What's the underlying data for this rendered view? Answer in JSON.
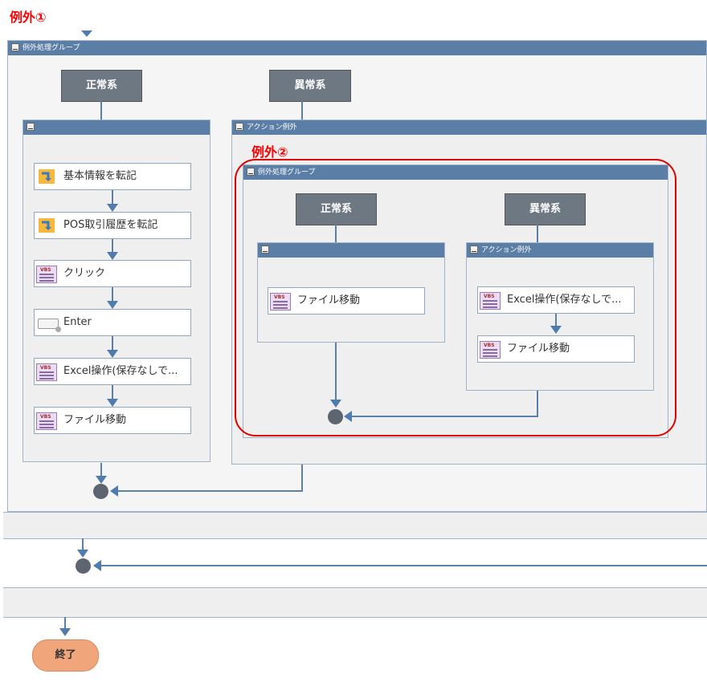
{
  "annotations": {
    "ex1": "例外①",
    "ex2": "例外②"
  },
  "outer_group": {
    "title": "例外処理グループ"
  },
  "outer_normal": {
    "branch_label": "正常系"
  },
  "outer_exception": {
    "branch_label": "異常系",
    "panel_title": "アクション例外"
  },
  "actions": [
    {
      "label": "基本情報を転記",
      "icon": "transfer-icon"
    },
    {
      "label": "POS取引履歴を転記",
      "icon": "transfer-icon"
    },
    {
      "label": "クリック",
      "icon": "vbs-script-icon"
    },
    {
      "label": "Enter",
      "icon": "keyboard-icon"
    },
    {
      "label": "Excel操作(保存なしで...",
      "icon": "vbs-script-icon"
    },
    {
      "label": "ファイル移動",
      "icon": "vbs-script-icon"
    }
  ],
  "inner_group": {
    "title": "例外処理グループ",
    "normal_label": "正常系",
    "exception_label": "異常系",
    "exception_panel_title": "アクション例外",
    "normal_action": "ファイル移動",
    "exception_actions": [
      "Excel操作(保存なしで...",
      "ファイル移動"
    ]
  },
  "end": {
    "label": "終了"
  }
}
